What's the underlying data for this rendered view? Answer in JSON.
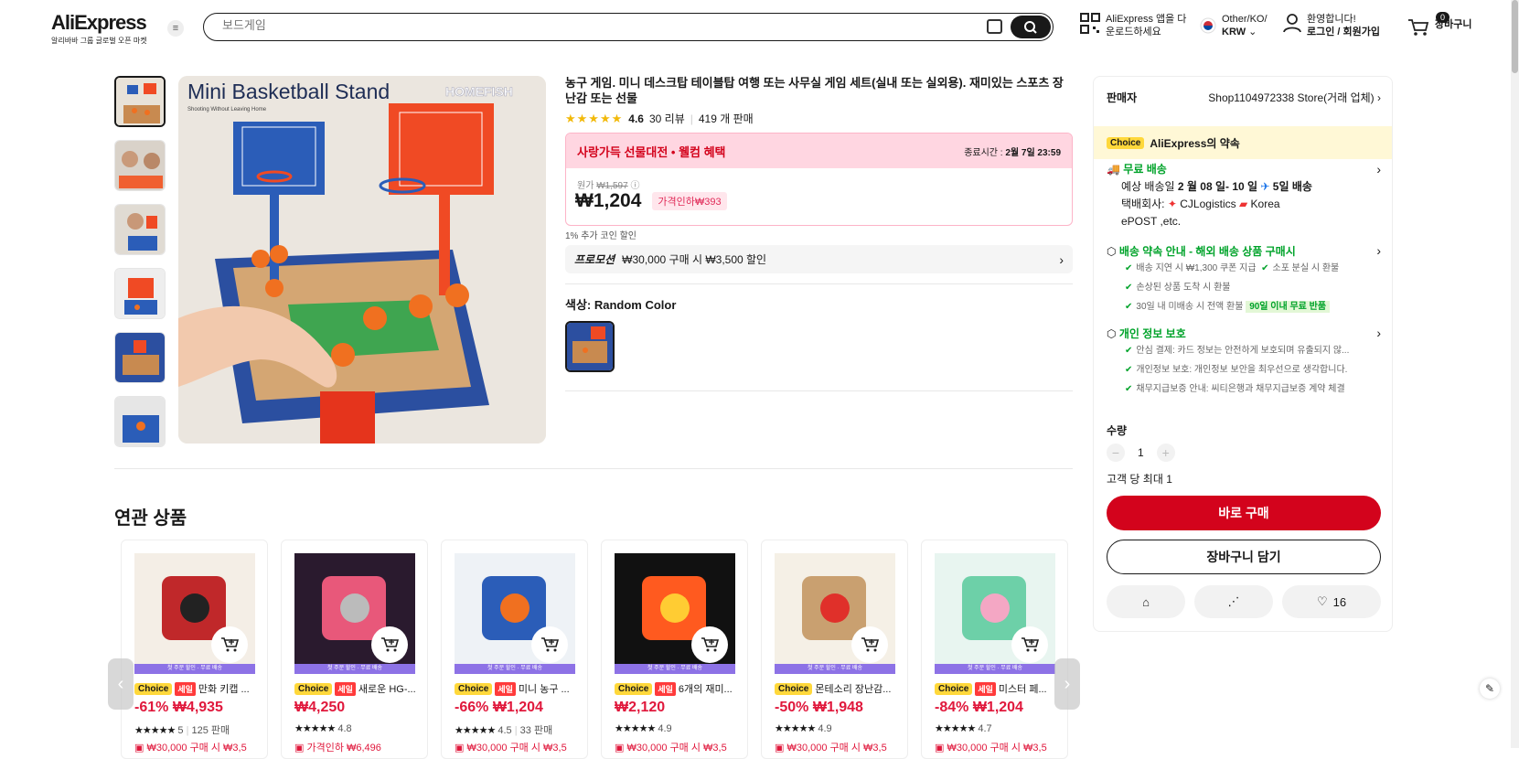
{
  "header": {
    "logo": "AliExpress",
    "logo_sub": "알리바바 그룹 글로벌 오픈 마켓",
    "search_placeholder": "보드게임",
    "app_line1": "AliExpress 앱을 다",
    "app_line2": "운로드하세요",
    "locale_line1": "Other/KO/",
    "locale_line2": "KRW",
    "user_line1": "환영합니다!",
    "user_line2": "로그인 / 회원가입",
    "cart_count": "0",
    "cart_label": "장바구니"
  },
  "gallery": {
    "main_title": "Mini Basketball Stand",
    "main_subtitle": "Shooting Without Leaving Home",
    "brand": "HOMEFISH"
  },
  "product": {
    "title": "농구 게임. 미니 데스크탑 테이블탑 여행 또는 사무실 게임 세트(실내 또는 실외용). 재미있는 스포츠 장난감 또는 선물",
    "rating": "4.6",
    "reviews": "30 리뷰",
    "sold": "419 개 판매",
    "deal_title": "사랑가득 선물대전 • 웰컴 혜택",
    "deal_time_label": "종료시간 :",
    "deal_time": "2월 7일 23:59",
    "orig_label": "원가",
    "orig_price": "₩1,597",
    "price": "₩1,204",
    "discount_tag": "가격인하₩393",
    "coin_text": "1% 추가 코인 할인",
    "promo_label": "프로모션",
    "promo_text": "₩30,000 구매 시 ₩3,500 할인",
    "color_label": "색상: Random Color"
  },
  "panel": {
    "seller_label": "판매자",
    "seller_name": "Shop1104972338 Store(거래 업체)",
    "choice_badge": "Choice",
    "choice_promise": "AliExpress의 약속",
    "shipping_title": "무료 배송",
    "shipping_date_prefix": "예상 배송일",
    "shipping_date": "2 월 08 일- 10 일",
    "shipping_days": "5일 배송",
    "carrier_label": "택배회사:",
    "carrier_line1": "CJLogistics",
    "carrier_line2": "Korea",
    "carrier_line3": "ePOST ,etc.",
    "guarantee_title": "배송 약속 안내 - 해외 배송 상품 구매시",
    "guarantee_items": [
      "배송 지연 시 ₩1,300 쿠폰 지급",
      "소포 분실 시 환불",
      "손상된 상품 도착 시 환불",
      "30일 내 미배송 시 전액 환불"
    ],
    "return_badge": "90일 이내 무료 반품",
    "privacy_title": "개인 정보 보호",
    "privacy_items": [
      "안심 결제: 카드 정보는 안전하게 보호되며 유출되지 않...",
      "개인정보 보호: 개인정보 보안을 최우선으로 생각합니다.",
      "채무지급보증 안내: 씨티은행과 채무지급보증 계약 체결"
    ],
    "qty_label": "수량",
    "qty": "1",
    "max_qty": "고객 당 최대 1",
    "buy_now": "바로 구매",
    "add_cart": "장바구니 담기",
    "wishlist_count": "16"
  },
  "related": {
    "title": "연관 상품",
    "banner": "첫 주문 할인 · 무료 배송",
    "cards": [
      {
        "name": "만화 키캡 ...",
        "discount": "-61%",
        "price": "₩4,935",
        "rating": "5",
        "sold": "125 판매",
        "promo": "₩30,000 구매 시 ₩3,5",
        "sale": true
      },
      {
        "name": "새로운 HG-...",
        "discount": "",
        "price": "₩4,250",
        "rating": "4.8",
        "sold": "",
        "promo": "가격인하 ₩6,496",
        "sale": true
      },
      {
        "name": "미니 농구 ...",
        "discount": "-66%",
        "price": "₩1,204",
        "rating": "4.5",
        "sold": "33 판매",
        "promo": "₩30,000 구매 시 ₩3,5",
        "sale": true
      },
      {
        "name": "6개의 재미...",
        "discount": "",
        "price": "₩2,120",
        "rating": "4.9",
        "sold": "",
        "promo": "₩30,000 구매 시 ₩3,5",
        "sale": true
      },
      {
        "name": "몬테소리 장난감...",
        "discount": "-50%",
        "price": "₩1,948",
        "rating": "4.9",
        "sold": "",
        "promo": "₩30,000 구매 시 ₩3,5",
        "sale": false
      },
      {
        "name": "미스터 페...",
        "discount": "-84%",
        "price": "₩1,204",
        "rating": "4.7",
        "sold": "",
        "promo": "₩30,000 구매 시 ₩3,5",
        "sale": true
      }
    ]
  },
  "colors": {
    "accent": "#d3031c",
    "choice": "#ffd83b",
    "green": "#00a32a",
    "pink": "#ffd6e1"
  }
}
